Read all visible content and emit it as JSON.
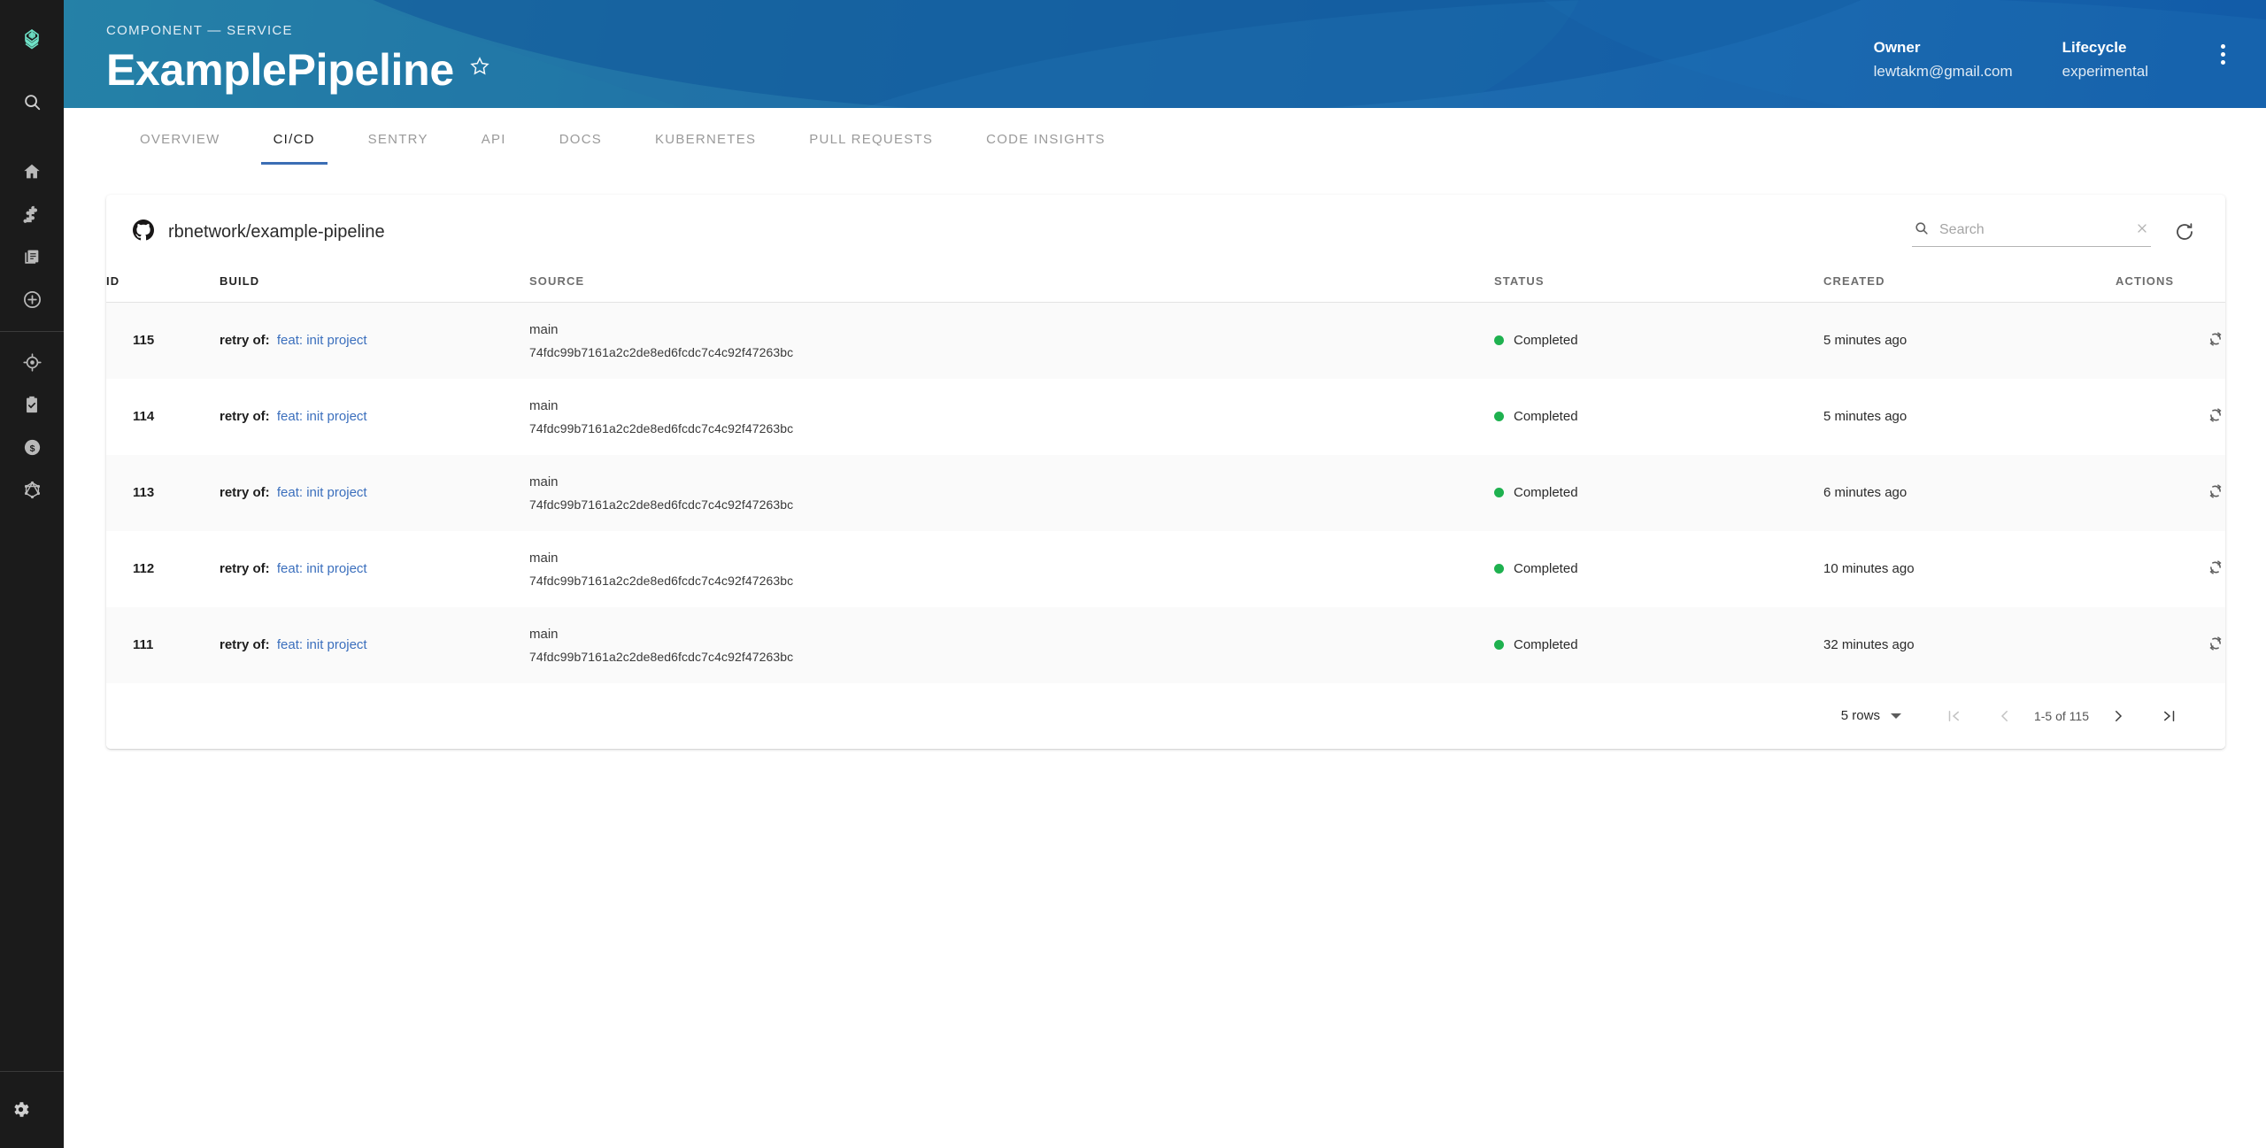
{
  "rail": {
    "logo_icon": "backstage-logo-icon",
    "search_icon": "search-icon",
    "items": [
      {
        "icon": "home-icon",
        "name": "home"
      },
      {
        "icon": "puzzle-icon",
        "name": "plugins"
      },
      {
        "icon": "library-icon",
        "name": "docs"
      },
      {
        "icon": "plus-circle-icon",
        "name": "create"
      },
      {
        "icon": "radar-icon",
        "name": "tech-radar"
      },
      {
        "icon": "clipboard-check-icon",
        "name": "tech-insights"
      },
      {
        "icon": "dollar-circle-icon",
        "name": "cost-insights"
      },
      {
        "icon": "graphql-icon",
        "name": "graphiql"
      }
    ],
    "settings_icon": "gear-icon"
  },
  "header": {
    "kicker": "COMPONENT — SERVICE",
    "title": "ExamplePipeline",
    "star_icon": "star-outline-icon",
    "owner_label": "Owner",
    "owner_value": "lewtakm@gmail.com",
    "lifecycle_label": "Lifecycle",
    "lifecycle_value": "experimental",
    "more_icon": "kebab-menu-icon",
    "gradient_from": "#2a8aa8",
    "gradient_to": "#0f56a4"
  },
  "tabs": [
    {
      "label": "OVERVIEW",
      "active": false
    },
    {
      "label": "CI/CD",
      "active": true
    },
    {
      "label": "SENTRY",
      "active": false
    },
    {
      "label": "API",
      "active": false
    },
    {
      "label": "DOCS",
      "active": false
    },
    {
      "label": "KUBERNETES",
      "active": false
    },
    {
      "label": "PULL REQUESTS",
      "active": false
    },
    {
      "label": "CODE INSIGHTS",
      "active": false
    }
  ],
  "card": {
    "repo_icon": "github-icon",
    "repo_name": "rbnetwork/example-pipeline",
    "search": {
      "icon": "search-icon",
      "placeholder": "Search",
      "value": "",
      "clear_icon": "close-icon"
    },
    "refresh_icon": "refresh-icon"
  },
  "table": {
    "columns": [
      {
        "key": "id",
        "label": "ID",
        "emphasis": "dark"
      },
      {
        "key": "build",
        "label": "BUILD",
        "emphasis": "dark"
      },
      {
        "key": "source",
        "label": "SOURCE",
        "emphasis": "light"
      },
      {
        "key": "status",
        "label": "STATUS",
        "emphasis": "light"
      },
      {
        "key": "created",
        "label": "CREATED",
        "emphasis": "light"
      },
      {
        "key": "actions",
        "label": "ACTIONS",
        "emphasis": "light"
      }
    ],
    "rows": [
      {
        "id": "115",
        "build_prefix": "retry of:",
        "build_link": "feat: init project",
        "branch": "main",
        "sha": "74fdc99b7161a2c2de8ed6fcdc7c4c92f47263bc",
        "status": "Completed",
        "status_color": "#1eb14f",
        "created": "5 minutes ago",
        "action_icon": "retry-icon"
      },
      {
        "id": "114",
        "build_prefix": "retry of:",
        "build_link": "feat: init project",
        "branch": "main",
        "sha": "74fdc99b7161a2c2de8ed6fcdc7c4c92f47263bc",
        "status": "Completed",
        "status_color": "#1eb14f",
        "created": "5 minutes ago",
        "action_icon": "retry-icon"
      },
      {
        "id": "113",
        "build_prefix": "retry of:",
        "build_link": "feat: init project",
        "branch": "main",
        "sha": "74fdc99b7161a2c2de8ed6fcdc7c4c92f47263bc",
        "status": "Completed",
        "status_color": "#1eb14f",
        "created": "6 minutes ago",
        "action_icon": "retry-icon"
      },
      {
        "id": "112",
        "build_prefix": "retry of:",
        "build_link": "feat: init project",
        "branch": "main",
        "sha": "74fdc99b7161a2c2de8ed6fcdc7c4c92f47263bc",
        "status": "Completed",
        "status_color": "#1eb14f",
        "created": "10 minutes ago",
        "action_icon": "retry-icon"
      },
      {
        "id": "111",
        "build_prefix": "retry of:",
        "build_link": "feat: init project",
        "branch": "main",
        "sha": "74fdc99b7161a2c2de8ed6fcdc7c4c92f47263bc",
        "status": "Completed",
        "status_color": "#1eb14f",
        "created": "32 minutes ago",
        "action_icon": "retry-icon"
      }
    ]
  },
  "pagination": {
    "rows_per_page": "5 rows",
    "first_icon": "first-page-icon",
    "prev_icon": "prev-page-icon",
    "range": "1-5 of 115",
    "next_icon": "next-page-icon",
    "last_icon": "last-page-icon"
  }
}
